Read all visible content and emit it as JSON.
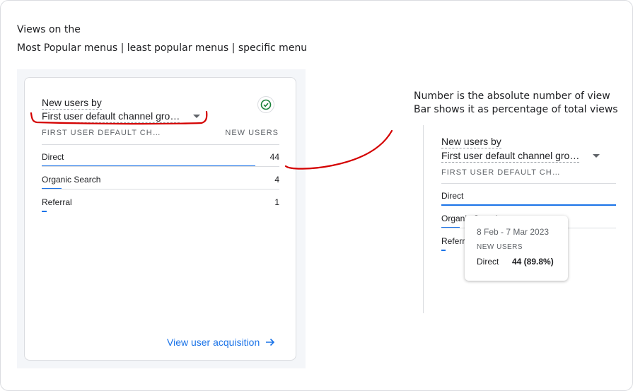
{
  "notes": {
    "line1": "Views on the",
    "line2": "Most Popular menus | least popular menus | specific menu",
    "right1": "Number is the absolute number of view",
    "right2": "Bar shows it as percentage of total views"
  },
  "card": {
    "title": "New users by",
    "dimension": "First user default channel gro…",
    "col_dimension": "FIRST USER DEFAULT CH…",
    "col_metric": "NEW USERS",
    "rows": [
      {
        "label": "Direct",
        "value": "44",
        "share": 0.898
      },
      {
        "label": "Organic Search",
        "value": "4",
        "share": 0.082
      },
      {
        "label": "Referral",
        "value": "1",
        "share": 0.02
      }
    ],
    "link_label": "View user acquisition"
  },
  "zoom": {
    "title": "New users by",
    "dimension": "First user default channel gro…",
    "col_dimension": "FIRST USER DEFAULT CH…",
    "rows": [
      {
        "label": "Direct"
      },
      {
        "label": "Organic Search"
      },
      {
        "label": "Referral"
      }
    ],
    "tooltip": {
      "date_range": "8 Feb - 7 Mar 2023",
      "metric": "NEW USERS",
      "label": "Direct",
      "value": "44 (89.8%)"
    }
  },
  "colors": {
    "accent": "#1a73e8",
    "annotation": "#d40000",
    "success": "#188038"
  }
}
